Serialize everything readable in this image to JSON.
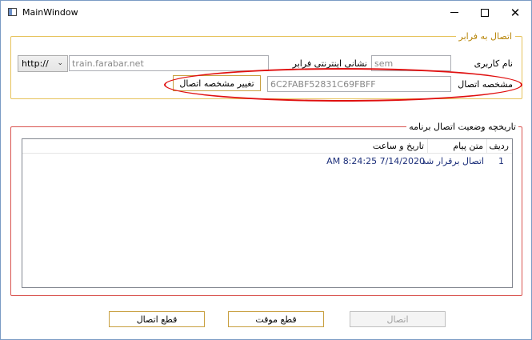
{
  "window": {
    "title": "MainWindow"
  },
  "connection_group": {
    "legend": "اتصال به فرابر",
    "username_label": "نام کاربری",
    "username_value": "sem",
    "url_label": "نشانی اینترنتی فرابر",
    "protocol_selected": "http://",
    "url_value": "train.farabar.net",
    "connection_id_label": "مشخصه اتصال",
    "connection_id_value": "6C2FABF52831C69FBFF",
    "change_id_button": "تغییر مشخصه اتصال"
  },
  "history_group": {
    "legend": "تاریخچه وضعیت اتصال برنامه",
    "columns": {
      "index": "ردیف",
      "message": "متن پیام",
      "datetime": "تاریخ و ساعت"
    },
    "rows": [
      {
        "index": "1",
        "message": "اتصال برقرار شد",
        "datetime": "7/14/2020 8:24:25 AM"
      }
    ]
  },
  "actions": {
    "connect": "اتصال",
    "pause": "قطع موقت",
    "disconnect": "قطع اتصال"
  },
  "colors": {
    "group_border_connection": "#e6c25a",
    "group_border_history": "#d9534f",
    "button_border": "#c8a040",
    "annotation": "#e01010"
  }
}
